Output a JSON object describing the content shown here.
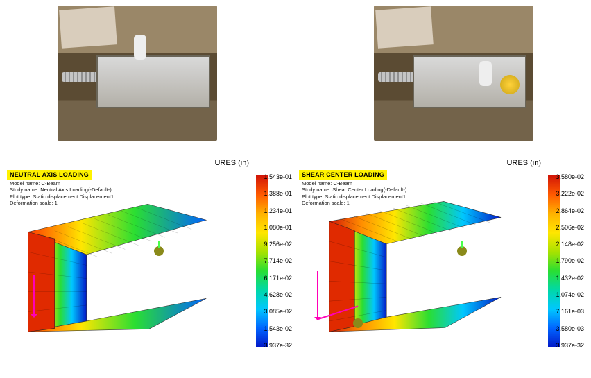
{
  "photos": {
    "left_name": "photo-neutral-axis-loading",
    "right_name": "photo-shear-center-loading"
  },
  "sim_left": {
    "banner": "NEUTRAL AXIS LOADING",
    "model": "Model name: C-Beam",
    "study": "Study name: Neutral Axis Loading(-Default-)",
    "plot": "Plot type: Static displacement Displacement1",
    "deform": "Deformation scale: 1",
    "unit": "URES (in)",
    "ticks": [
      "1.543e-01",
      "1.388e-01",
      "1.234e-01",
      "1.080e-01",
      "9.256e-02",
      "7.714e-02",
      "6.171e-02",
      "4.628e-02",
      "3.085e-02",
      "1.543e-02",
      "3.937e-32"
    ]
  },
  "sim_right": {
    "banner": "SHEAR CENTER LOADING",
    "model": "Model name: C-Beam",
    "study": "Study name: Shear Center Loading(-Default-)",
    "plot": "Plot type: Static displacement Displacement1",
    "deform": "Deformation scale: 1",
    "unit": "URES (in)",
    "ticks": [
      "3.580e-02",
      "3.222e-02",
      "2.864e-02",
      "2.506e-02",
      "2.148e-02",
      "1.790e-02",
      "1.432e-02",
      "1.074e-02",
      "7.161e-03",
      "3.580e-03",
      "3.937e-32"
    ]
  },
  "chart_data": [
    {
      "type": "heatmap",
      "title": "NEUTRAL AXIS LOADING",
      "quantity": "URES (in)",
      "model": "C-Beam",
      "study": "Neutral Axis Loading(-Default-)",
      "plot_type": "Static displacement Displacement1",
      "deformation_scale": 1,
      "colorbar_range": [
        3.937e-32,
        0.1543
      ],
      "colorbar_ticks": [
        0.1543,
        0.1388,
        0.1234,
        0.108,
        0.09256,
        0.07714,
        0.06171,
        0.04628,
        0.03085,
        0.01543,
        3.937e-32
      ],
      "notes": "Max displacement at free-end flange tips (red); fixed end near zero (blue); visible twist of C-section."
    },
    {
      "type": "heatmap",
      "title": "SHEAR CENTER LOADING",
      "quantity": "URES (in)",
      "model": "C-Beam",
      "study": "Shear Center Loading(-Default-)",
      "plot_type": "Static displacement Displacement1",
      "deformation_scale": 1,
      "colorbar_range": [
        3.937e-32,
        0.0358
      ],
      "colorbar_ticks": [
        0.0358,
        0.03222,
        0.02864,
        0.02506,
        0.02148,
        0.0179,
        0.01432,
        0.01074,
        0.007161,
        0.00358,
        3.937e-32
      ],
      "notes": "Max displacement at free end (red) uniformly across section; fixed end blue; negligible twist."
    }
  ]
}
